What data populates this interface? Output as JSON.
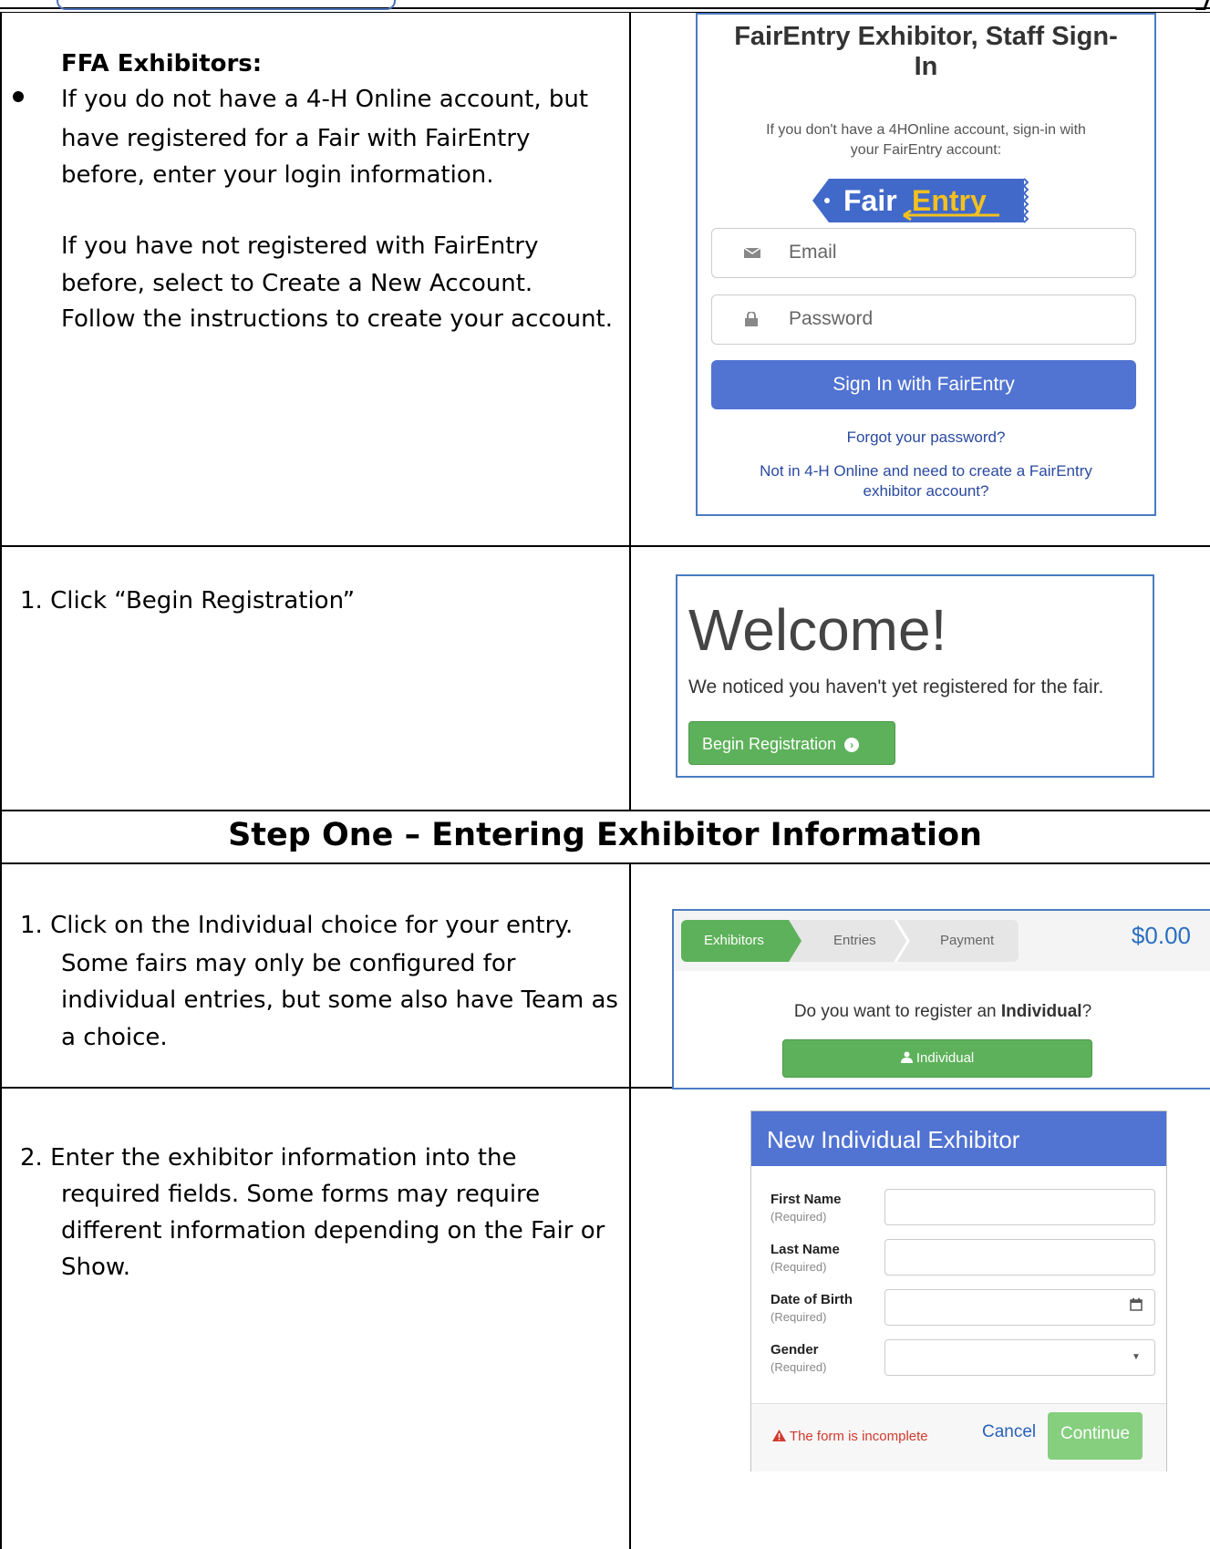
{
  "rows": {
    "ffa": {
      "title": "FFA Exhibitors:",
      "bullet_lines": [
        "If you do not have a 4-H Online account, but",
        "have registered for a Fair with FairEntry",
        "before, enter your login information."
      ],
      "para_lines": [
        "If you have not registered with FairEntry",
        "before, select to Create a New Account.",
        "Follow the instructions to create your account."
      ]
    },
    "begin": {
      "text": "1.  Click “Begin Registration”"
    },
    "step_heading": "Step One – Entering Exhibitor Information",
    "individual": {
      "lines": [
        "1.  Click on the Individual choice for your entry.",
        "Some fairs may only be configured for",
        "individual entries, but some also have Team as",
        "a choice."
      ]
    },
    "exhibitor_info": {
      "lines": [
        "2.  Enter the exhibitor information into the",
        "required fields. Some forms may require",
        "different information depending on the Fair or",
        "Show."
      ]
    }
  },
  "signin": {
    "title_line1": "FairEntry Exhibitor, Staff Sign-",
    "title_line2": "In",
    "help_line1": "If you don't have a 4HOnline account, sign-in with",
    "help_line2": "your FairEntry account:",
    "logo_fair": "Fair",
    "logo_entry": "Entry",
    "email_placeholder": "Email",
    "password_placeholder": "Password",
    "button": "Sign In with FairEntry",
    "forgot": "Forgot your password?",
    "create_line1": "Not in 4-H Online and need to create a FairEntry",
    "create_line2": "exhibitor account?"
  },
  "welcome": {
    "title": "Welcome!",
    "subtitle": "We noticed you haven't yet registered for the fair.",
    "button": "Begin Registration"
  },
  "register": {
    "steps": [
      "Exhibitors",
      "Entries",
      "Payment"
    ],
    "price": "$0.00",
    "question_pre": "Do you want to register an ",
    "question_bold": "Individual",
    "question_post": "?",
    "button": "Individual"
  },
  "form": {
    "title": "New Individual Exhibitor",
    "fields": [
      {
        "label": "First Name",
        "note": "(Required)"
      },
      {
        "label": "Last Name",
        "note": "(Required)"
      },
      {
        "label": "Date of Birth",
        "note": "(Required)"
      },
      {
        "label": "Gender",
        "note": "(Required)"
      }
    ],
    "warning": "The form is incomplete",
    "cancel": "Cancel",
    "continue": "Continue"
  },
  "colors": {
    "primary_blue": "#5173d2",
    "success_green": "#5db15a",
    "border_blue": "#4a7bc4",
    "danger_red": "#d23a2e"
  }
}
